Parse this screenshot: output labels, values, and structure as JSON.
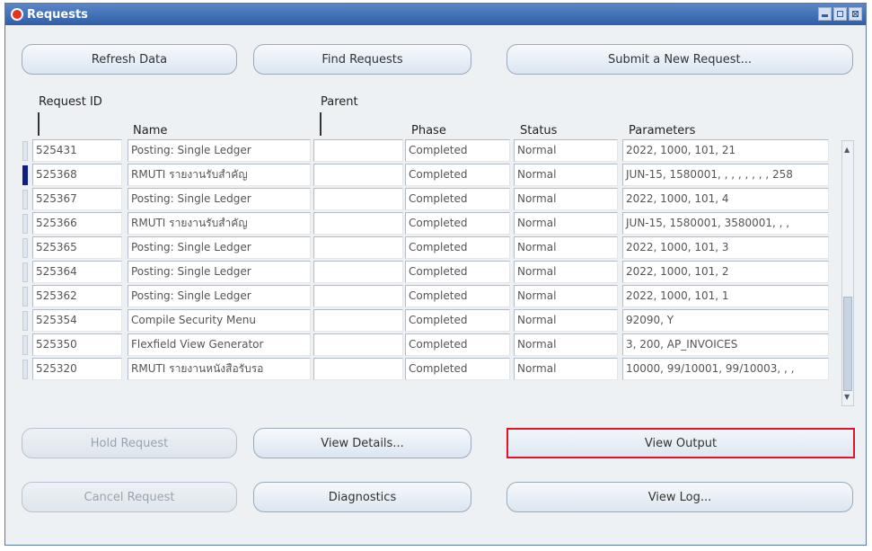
{
  "window": {
    "title": "Requests"
  },
  "top_buttons": {
    "refresh": "Refresh Data",
    "find": "Find Requests",
    "submit": "Submit a New Request..."
  },
  "columns": {
    "request_id": "Request ID",
    "parent": "Parent",
    "name": "Name",
    "phase": "Phase",
    "status": "Status",
    "parameters": "Parameters"
  },
  "rows": [
    {
      "id": "525431",
      "name": "Posting: Single Ledger",
      "parent": "",
      "phase": "Completed",
      "status": "Normal",
      "params": "2022, 1000, 101, 21"
    },
    {
      "id": "525368",
      "name": "RMUTI รายงานรับสำคัญ",
      "parent": "",
      "phase": "Completed",
      "status": "Normal",
      "params": "JUN-15, 1580001, , , , , , , , 258"
    },
    {
      "id": "525367",
      "name": "Posting: Single Ledger",
      "parent": "",
      "phase": "Completed",
      "status": "Normal",
      "params": "2022, 1000, 101, 4"
    },
    {
      "id": "525366",
      "name": "RMUTI รายงานรับสำคัญ",
      "parent": "",
      "phase": "Completed",
      "status": "Normal",
      "params": "JUN-15, 1580001, 3580001, , ,"
    },
    {
      "id": "525365",
      "name": "Posting: Single Ledger",
      "parent": "",
      "phase": "Completed",
      "status": "Normal",
      "params": "2022, 1000, 101, 3"
    },
    {
      "id": "525364",
      "name": "Posting: Single Ledger",
      "parent": "",
      "phase": "Completed",
      "status": "Normal",
      "params": "2022, 1000, 101, 2"
    },
    {
      "id": "525362",
      "name": "Posting: Single Ledger",
      "parent": "",
      "phase": "Completed",
      "status": "Normal",
      "params": "2022, 1000, 101, 1"
    },
    {
      "id": "525354",
      "name": "Compile Security Menu",
      "parent": "",
      "phase": "Completed",
      "status": "Normal",
      "params": "92090, Y"
    },
    {
      "id": "525350",
      "name": "Flexfield View Generator",
      "parent": "",
      "phase": "Completed",
      "status": "Normal",
      "params": "3, 200, AP_INVOICES"
    },
    {
      "id": "525320",
      "name": "RMUTI รายงานหนังสือรับรอ",
      "parent": "",
      "phase": "Completed",
      "status": "Normal",
      "params": "10000, 99/10001, 99/10003, , ,"
    }
  ],
  "bottom_buttons": {
    "hold": "Hold Request",
    "details": "View Details...",
    "output": "View Output",
    "cancel": "Cancel Request",
    "diagnostics": "Diagnostics",
    "log": "View Log..."
  },
  "active_row_index": 1,
  "colors": {
    "title_bar": "#2f5fa8",
    "highlight_border": "#e0152a",
    "active_indicator": "#0f1e8c"
  }
}
